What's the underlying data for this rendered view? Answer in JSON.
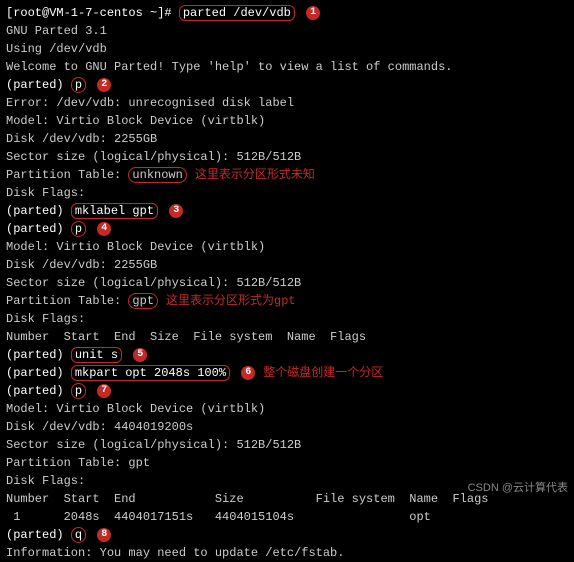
{
  "prompt": {
    "shell": "[root@VM-1-7-centos ~]#",
    "parted": "(parted)"
  },
  "cmd": {
    "initial": "parted /dev/vdb",
    "p": "p",
    "mklabel": "mklabel gpt",
    "unit": "unit s",
    "mkpart": "mkpart opt 2048s 100%",
    "quit": "q"
  },
  "marker": {
    "1": "1",
    "2": "2",
    "3": "3",
    "4": "4",
    "5": "5",
    "6": "6",
    "7": "7",
    "8": "8"
  },
  "lines": {
    "gnu": "GNU Parted 3.1",
    "using": "Using /dev/vdb",
    "welcome": "Welcome to GNU Parted! Type 'help' to view a list of commands.",
    "error": "Error: /dev/vdb: unrecognised disk label",
    "model": "Model: Virtio Block Device (virtblk)",
    "disk1": "Disk /dev/vdb: 2255GB",
    "sector": "Sector size (logical/physical): 512B/512B",
    "pt_label": "Partition Table: ",
    "pt_unknown": "unknown",
    "pt_gpt": "gpt",
    "flags": "Disk Flags:",
    "blank": "",
    "header1": "Number  Start  End  Size  File system  Name  Flags",
    "disk2": "Disk /dev/vdb: 4404019200s",
    "header2": "Number  Start  End           Size          File system  Name  Flags",
    "row": " 1      2048s  4404017151s   4404015104s                opt",
    "info": "Information: You may need to update /etc/fstab."
  },
  "notes": {
    "unknown": "这里表示分区形式未知",
    "gpt": "这里表示分区形式为gpt",
    "whole": "整个磁盘创建一个分区"
  },
  "watermark": "CSDN @云计算代表"
}
